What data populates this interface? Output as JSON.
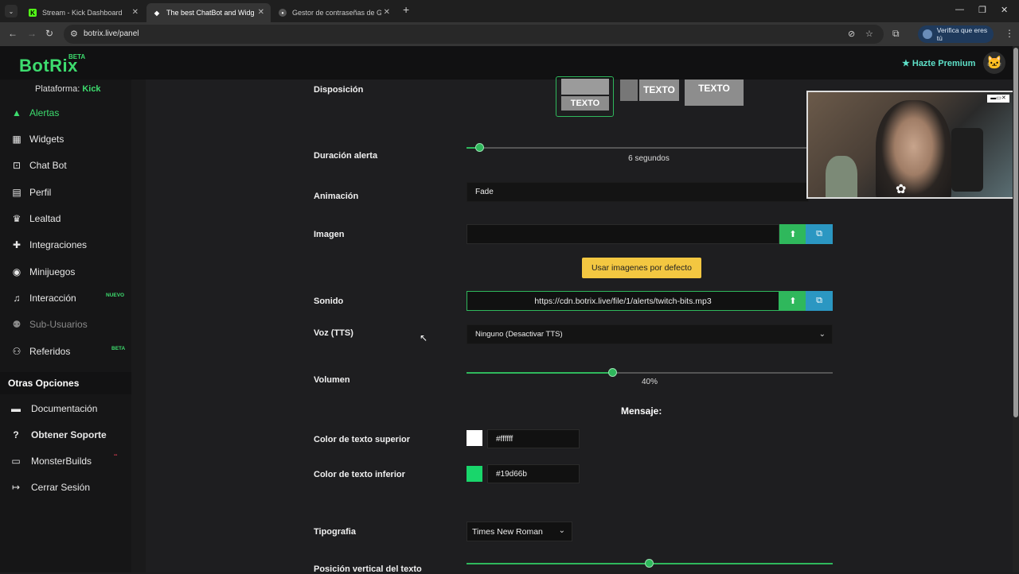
{
  "browser": {
    "tabs": [
      {
        "label": "Stream - Kick Dashboard",
        "active": false
      },
      {
        "label": "The best ChatBot and Widgets",
        "active": true
      },
      {
        "label": "Gestor de contraseñas de Goo",
        "active": false
      }
    ],
    "url": "botrix.live/panel",
    "verify_label": "Verifica que eres tú"
  },
  "header": {
    "logo": "BotRix",
    "logo_badge": "BETA",
    "premium_label": "Hazte Premium"
  },
  "sidebar": {
    "platform_label": "Plataforma:",
    "platform_value": "Kick",
    "items": [
      {
        "label": "Alertas",
        "icon": "warning-icon"
      },
      {
        "label": "Widgets",
        "icon": "widgets-icon"
      },
      {
        "label": "Chat Bot",
        "icon": "robot-icon"
      },
      {
        "label": "Perfil",
        "icon": "id-card-icon"
      },
      {
        "label": "Lealtad",
        "icon": "trophy-icon"
      },
      {
        "label": "Integraciones",
        "icon": "puzzle-icon"
      },
      {
        "label": "Minijuegos",
        "icon": "gamepad-icon"
      },
      {
        "label": "Interacción",
        "icon": "music-icon",
        "badge": "NUEVO"
      },
      {
        "label": "Sub-Usuarios",
        "icon": "users-cog-icon"
      },
      {
        "label": "Referidos",
        "icon": "users-icon",
        "badge": "BETA"
      }
    ],
    "other_heading": "Otras Opciones",
    "other_items": [
      {
        "label": "Documentación",
        "icon": "book-icon"
      },
      {
        "label": "Obtener Soporte",
        "icon": "help-icon"
      },
      {
        "label": "MonsterBuilds",
        "icon": "laptop-icon"
      },
      {
        "label": "Cerrar Sesión",
        "icon": "logout-icon"
      }
    ]
  },
  "form": {
    "disposicion_label": "Disposición",
    "layout_option_text": "TEXTO",
    "duracion_label": "Duración alerta",
    "duracion_value": "6 segundos",
    "duracion_fraction": 0.04,
    "animacion_label": "Animación",
    "animacion_value": "Fade",
    "imagen_label": "Imagen",
    "imagen_value": "",
    "default_images_button": "Usar imagenes por defecto",
    "sonido_label": "Sonido",
    "sonido_value": "https://cdn.botrix.live/file/1/alerts/twitch-bits.mp3",
    "voz_label": "Voz (TTS)",
    "voz_value": "Ninguno (Desactivar TTS)",
    "volumen_label": "Volumen",
    "volumen_value": "40%",
    "volumen_fraction": 0.4,
    "mensaje_heading": "Mensaje:",
    "color_sup_label": "Color de texto superior",
    "color_sup_value": "#ffffff",
    "color_inf_label": "Color de texto inferior",
    "color_inf_value": "#19d66b",
    "tipografia_label": "Tipografia",
    "tipografia_value": "Times New Roman",
    "posicion_label": "Posición vertical del texto",
    "posicion_fraction": 0.5
  },
  "colors": {
    "accent": "#3ddc6e",
    "upload": "#2fb85c",
    "gallery": "#2b97c2",
    "default_btn": "#f3c741"
  }
}
